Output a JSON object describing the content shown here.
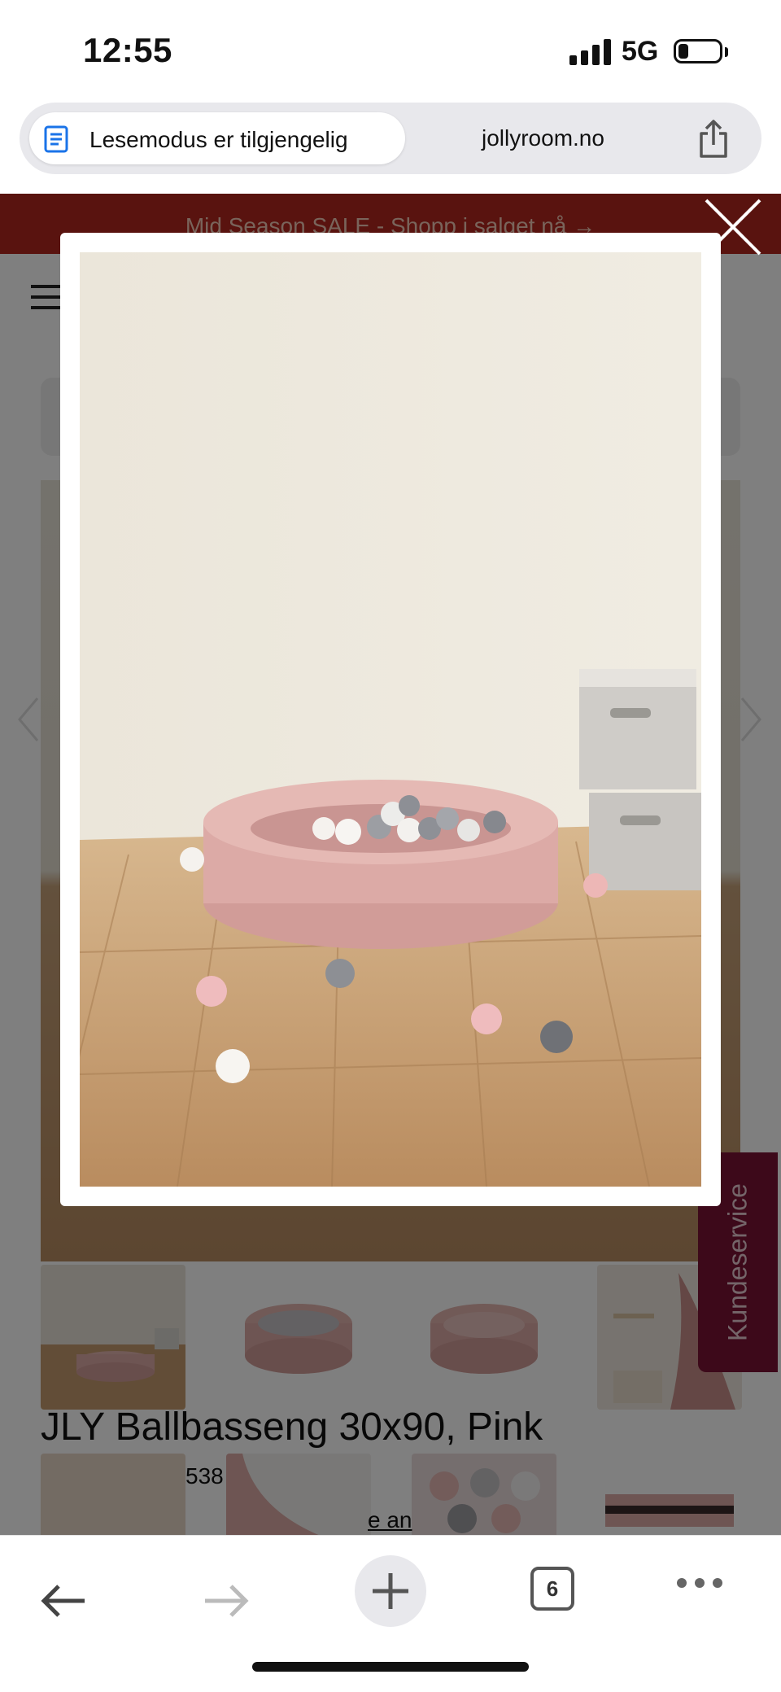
{
  "status_bar": {
    "time": "12:55",
    "network": "5G",
    "battery_level": 0.25
  },
  "browser": {
    "reader_mode_label": "Lesemodus er tilgjengelig",
    "domain": "jollyroom.no",
    "open_tabs": "6"
  },
  "page": {
    "promo_banner": "Mid Season SALE - Shopp i salget nå →",
    "product_title": "JLY Ballbasseng 30x90, Pink",
    "review_count_partial": "538",
    "review_link_partial": "e an",
    "support_tab": "Kundeservice"
  },
  "colors": {
    "promo_bg": "#b3261e",
    "support_tab_bg": "#7a1234",
    "pool_pink": "#dcaaa6",
    "floor_wood": "#c8a27a"
  },
  "icons": {
    "reader": "reader-mode-icon",
    "share": "share-icon",
    "close": "close-icon",
    "back": "back-arrow-icon",
    "forward": "forward-arrow-icon",
    "new_tab": "plus-icon",
    "tabs": "tabs-icon",
    "more": "more-dots-icon"
  }
}
